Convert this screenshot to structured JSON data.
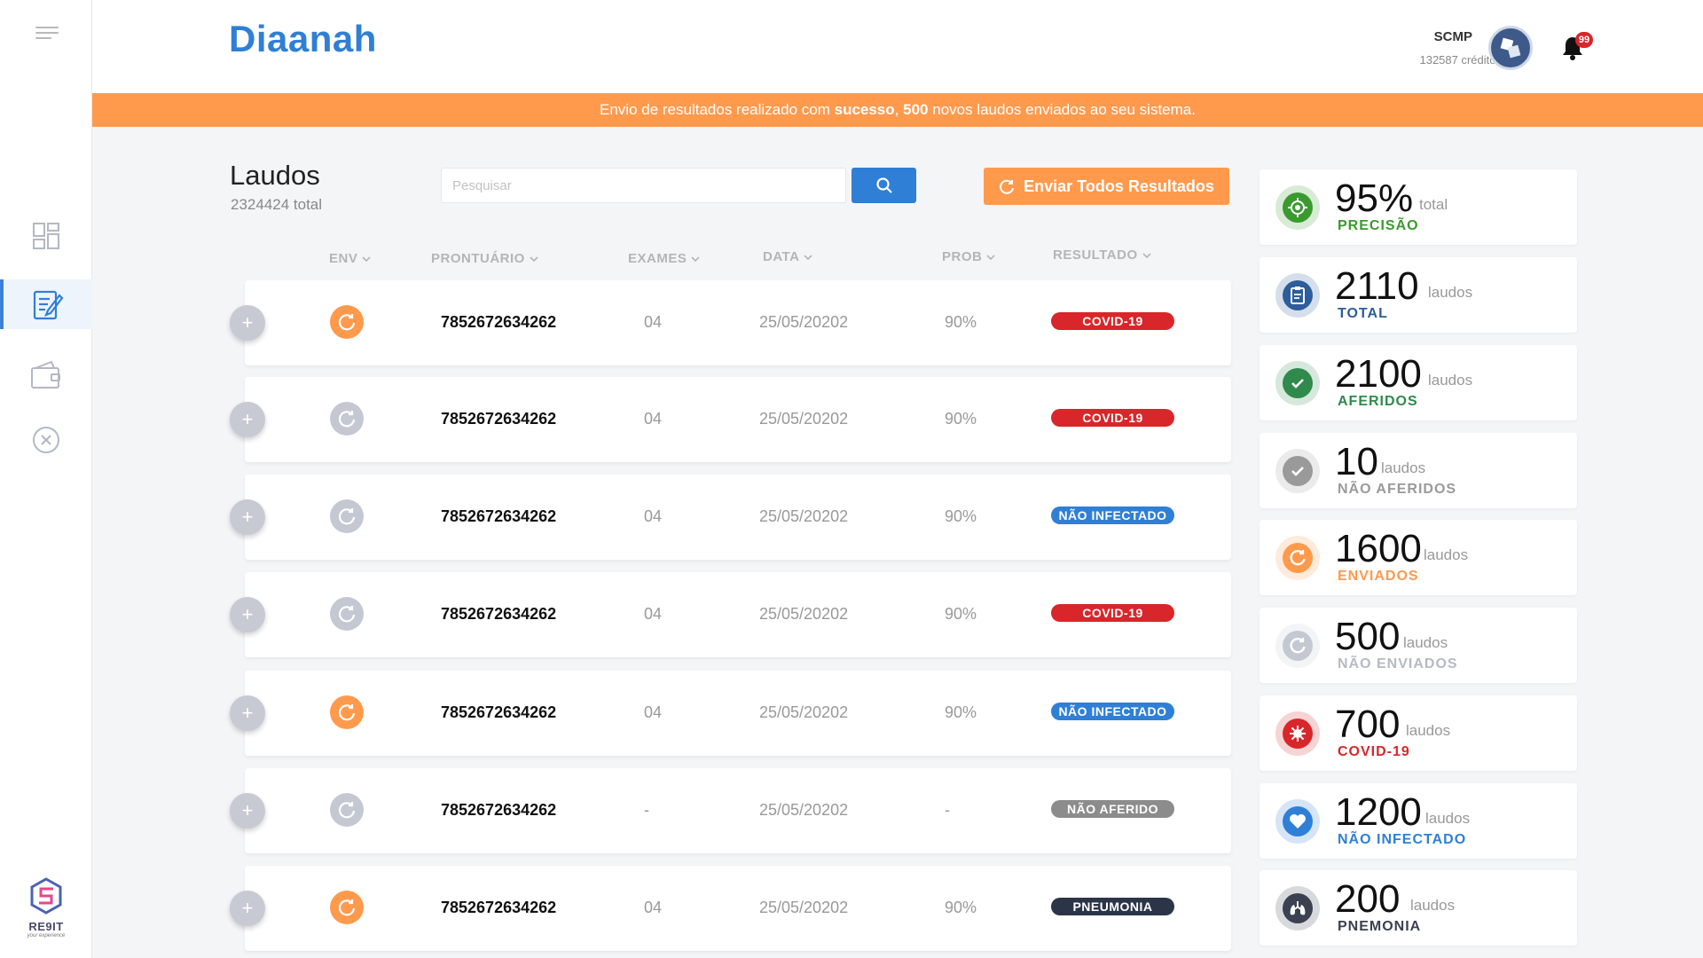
{
  "app": {
    "logo": "Diaanah"
  },
  "sidebar": {
    "items": [
      {
        "name": "sidebar-item-dashboard",
        "icon": "dashboard-icon"
      },
      {
        "name": "sidebar-item-laudos",
        "icon": "report-edit-icon"
      },
      {
        "name": "sidebar-item-wallet",
        "icon": "wallet-icon"
      },
      {
        "name": "sidebar-item-cancel",
        "icon": "close-circle-icon"
      }
    ],
    "brand": "RE9IT",
    "brand_tagline": "your experience"
  },
  "header": {
    "user_name": "SCMP",
    "credits": "132587 créditos",
    "notifications": "99"
  },
  "banner": {
    "prefix": "Envio de resultados realizado com ",
    "bold1": "sucesso",
    "sep": ", ",
    "bold2": "500",
    "suffix": " novos laudos enviados ao seu sistema."
  },
  "page": {
    "title": "Laudos",
    "total": "2324424 total"
  },
  "search": {
    "placeholder": "Pesquisar"
  },
  "actions": {
    "send_all": "Enviar Todos Resultados"
  },
  "table": {
    "headers": {
      "env": "ENV",
      "prontuario": "PRONTUÁRIO",
      "exames": "EXAMES",
      "data": "DATA",
      "prob": "PROB",
      "resultado": "RESULTADO"
    },
    "rows": [
      {
        "env": "sent",
        "prontuario": "7852672634262",
        "exames": "04",
        "data": "25/05/20202",
        "prob": "90%",
        "resultado": "COVID-19",
        "color": "#d9262a"
      },
      {
        "env": "pending",
        "prontuario": "7852672634262",
        "exames": "04",
        "data": "25/05/20202",
        "prob": "90%",
        "resultado": "COVID-19",
        "color": "#d9262a"
      },
      {
        "env": "pending",
        "prontuario": "7852672634262",
        "exames": "04",
        "data": "25/05/20202",
        "prob": "90%",
        "resultado": "NÃO INFECTADO",
        "color": "#2f7fd6"
      },
      {
        "env": "pending",
        "prontuario": "7852672634262",
        "exames": "04",
        "data": "25/05/20202",
        "prob": "90%",
        "resultado": "COVID-19",
        "color": "#d9262a"
      },
      {
        "env": "sent",
        "prontuario": "7852672634262",
        "exames": "04",
        "data": "25/05/20202",
        "prob": "90%",
        "resultado": "NÃO INFECTADO",
        "color": "#2f7fd6"
      },
      {
        "env": "pending",
        "prontuario": "7852672634262",
        "exames": "-",
        "data": "25/05/20202",
        "prob": "-",
        "resultado": "NÃO AFERIDO",
        "color": "#8c8c8c"
      },
      {
        "env": "sent",
        "prontuario": "7852672634262",
        "exames": "04",
        "data": "25/05/20202",
        "prob": "90%",
        "resultado": "PNEUMONIA",
        "color": "#2c3548"
      }
    ]
  },
  "stats": [
    {
      "value": "95%",
      "unit": "total",
      "label": "PRECISÃO",
      "color": "#3a9a2f",
      "icon": "target-icon"
    },
    {
      "value": "2110",
      "unit": "laudos",
      "label": "TOTAL",
      "color": "#2d5d9b",
      "icon": "clipboard-icon"
    },
    {
      "value": "2100",
      "unit": "laudos",
      "label": "AFERIDOS",
      "color": "#2f8a4c",
      "icon": "check-circle-icon"
    },
    {
      "value": "10",
      "unit": "laudos",
      "label": "NÃO AFERIDOS",
      "color": "#9a9a9a",
      "icon": "check-circle-icon"
    },
    {
      "value": "1600",
      "unit": "laudos",
      "label": "ENVIADOS",
      "color": "#ff9a4d",
      "icon": "sync-icon"
    },
    {
      "value": "500",
      "unit": "laudos",
      "label": "NÃO ENVIADOS",
      "color": "#c4c8d2",
      "icon": "sync-icon"
    },
    {
      "value": "700",
      "unit": "laudos",
      "label": "COVID-19",
      "color": "#d9262a",
      "icon": "virus-icon"
    },
    {
      "value": "1200",
      "unit": "laudos",
      "label": "NÃO INFECTADO",
      "color": "#2f7fd6",
      "icon": "heart-icon"
    },
    {
      "value": "200",
      "unit": "laudos",
      "label": "PNEMONIA",
      "color": "#3b4150",
      "icon": "lungs-icon"
    }
  ],
  "colors": {
    "accent": "#2f7fd6",
    "orange": "#ff9a4d",
    "pending": "#c4c8d2"
  }
}
